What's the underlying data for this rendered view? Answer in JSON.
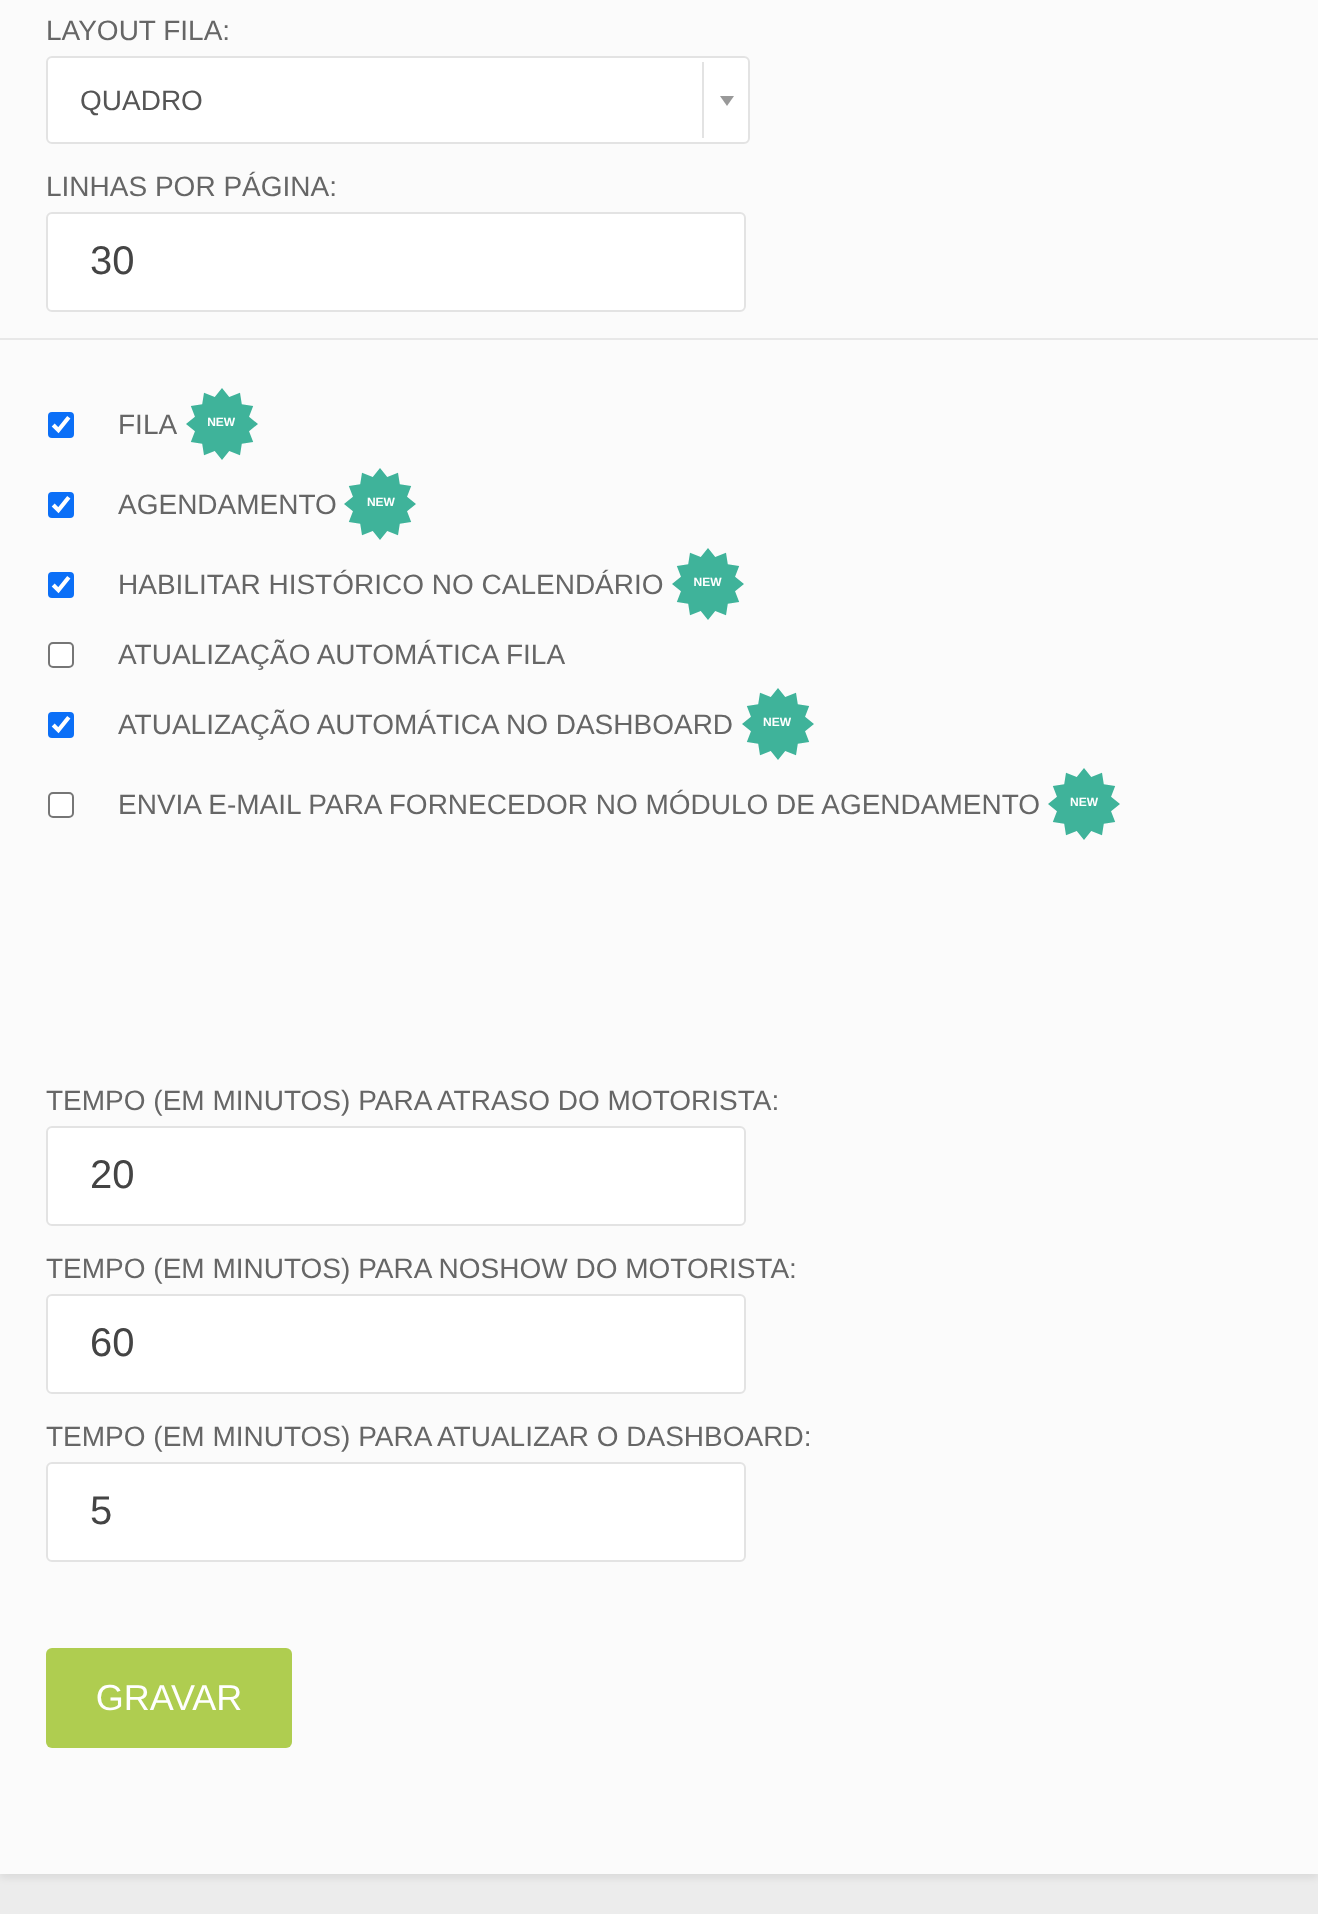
{
  "layout_fila": {
    "label": "LAYOUT FILA:",
    "value": "QUADRO"
  },
  "linhas_por_pagina": {
    "label": "LINHAS POR PÁGINA:",
    "value": "30"
  },
  "options": [
    {
      "label": "FILA",
      "checked": true,
      "badge": "NEW"
    },
    {
      "label": "AGENDAMENTO",
      "checked": true,
      "badge": "NEW"
    },
    {
      "label": "HABILITAR HISTÓRICO NO CALENDÁRIO",
      "checked": true,
      "badge": "NEW"
    },
    {
      "label": "ATUALIZAÇÃO AUTOMÁTICA FILA",
      "checked": false
    },
    {
      "label": "ATUALIZAÇÃO AUTOMÁTICA NO DASHBOARD",
      "checked": true,
      "badge": "NEW"
    },
    {
      "label": "ENVIA E-MAIL PARA FORNECEDOR NO MÓDULO DE AGENDAMENTO",
      "checked": false,
      "badge": "NEW"
    }
  ],
  "time_fields": [
    {
      "label": "TEMPO (EM MINUTOS) PARA ATRASO DO MOTORISTA:",
      "value": "20"
    },
    {
      "label": "TEMPO (EM MINUTOS) PARA NOSHOW DO MOTORISTA:",
      "value": "60"
    },
    {
      "label": "TEMPO (EM MINUTOS) PARA ATUALIZAR O DASHBOARD:",
      "value": "5"
    }
  ],
  "save_button": "GRAVAR"
}
